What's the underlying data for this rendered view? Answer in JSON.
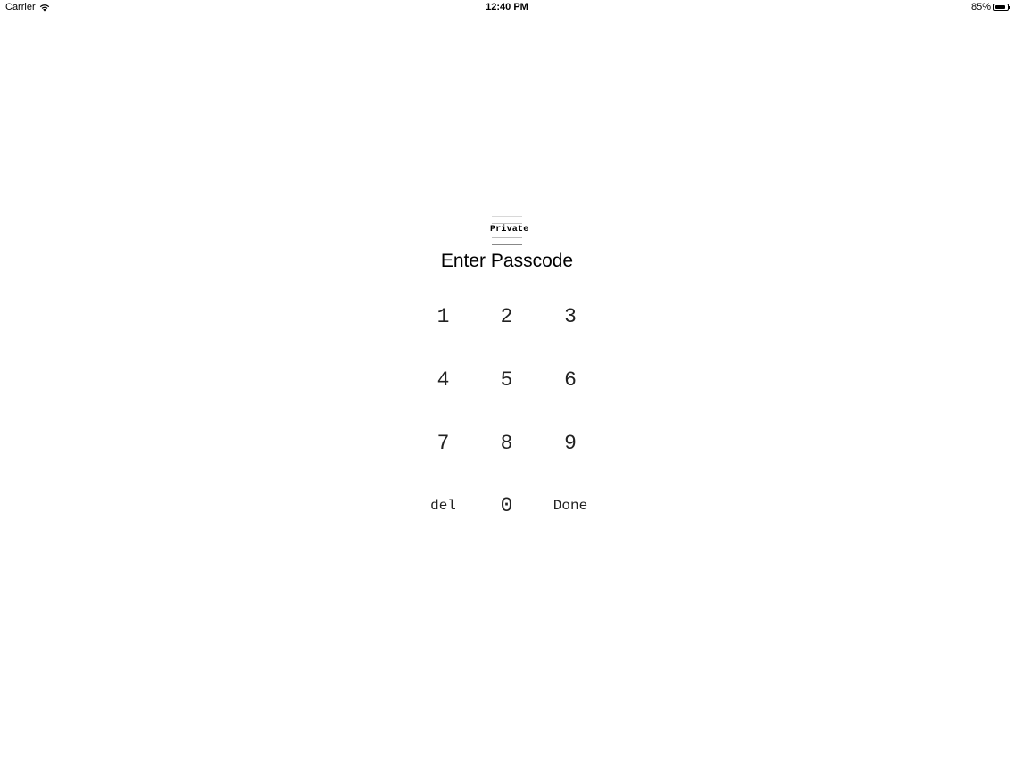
{
  "status_bar": {
    "carrier": "Carrier",
    "time": "12:40 PM",
    "battery_percent": "85%",
    "battery_level": 0.85,
    "wifi_icon": "wifi-icon",
    "battery_icon": "battery-icon"
  },
  "logo": {
    "text": "Private"
  },
  "title": "Enter Passcode",
  "keypad": {
    "keys": [
      "1",
      "2",
      "3",
      "4",
      "5",
      "6",
      "7",
      "8",
      "9",
      "del",
      "0",
      "Done"
    ]
  }
}
